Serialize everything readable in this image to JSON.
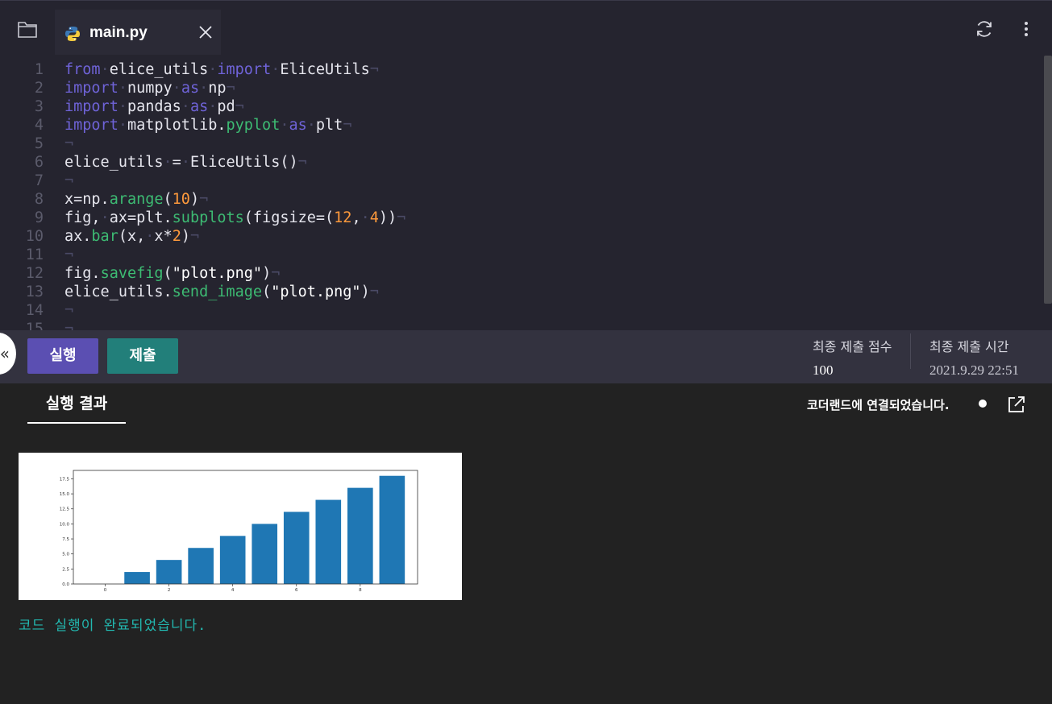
{
  "tab": {
    "filename": "main.py",
    "folder_icon": "folder-icon",
    "python_icon": "python-icon",
    "close_icon": "close-icon"
  },
  "toolbar": {
    "refresh_icon": "refresh-icon",
    "more_icon": "more-vertical-icon"
  },
  "code": {
    "lines": [
      {
        "n": "1",
        "tokens": [
          [
            "kw",
            "from"
          ],
          [
            "ws",
            "·"
          ],
          [
            "tx",
            "elice_utils"
          ],
          [
            "ws",
            "·"
          ],
          [
            "kw",
            "import"
          ],
          [
            "ws",
            "·"
          ],
          [
            "tx",
            "EliceUtils"
          ],
          [
            "ws",
            "¬"
          ]
        ]
      },
      {
        "n": "2",
        "tokens": [
          [
            "kw",
            "import"
          ],
          [
            "ws",
            "·"
          ],
          [
            "tx",
            "numpy"
          ],
          [
            "ws",
            "·"
          ],
          [
            "kw",
            "as"
          ],
          [
            "ws",
            "·"
          ],
          [
            "tx",
            "np"
          ],
          [
            "ws",
            "¬"
          ]
        ]
      },
      {
        "n": "3",
        "tokens": [
          [
            "kw",
            "import"
          ],
          [
            "ws",
            "·"
          ],
          [
            "tx",
            "pandas"
          ],
          [
            "ws",
            "·"
          ],
          [
            "kw",
            "as"
          ],
          [
            "ws",
            "·"
          ],
          [
            "tx",
            "pd"
          ],
          [
            "ws",
            "¬"
          ]
        ]
      },
      {
        "n": "4",
        "tokens": [
          [
            "kw",
            "import"
          ],
          [
            "ws",
            "·"
          ],
          [
            "tx",
            "matplotlib."
          ],
          [
            "fn",
            "pyplot"
          ],
          [
            "ws",
            "·"
          ],
          [
            "kw",
            "as"
          ],
          [
            "ws",
            "·"
          ],
          [
            "tx",
            "plt"
          ],
          [
            "ws",
            "¬"
          ]
        ]
      },
      {
        "n": "5",
        "tokens": [
          [
            "ws",
            "¬"
          ]
        ]
      },
      {
        "n": "6",
        "tokens": [
          [
            "tx",
            "elice_utils"
          ],
          [
            "ws",
            "·"
          ],
          [
            "tx",
            "="
          ],
          [
            "ws",
            "·"
          ],
          [
            "tx",
            "EliceUtils()"
          ],
          [
            "ws",
            "¬"
          ]
        ]
      },
      {
        "n": "7",
        "tokens": [
          [
            "ws",
            "¬"
          ]
        ]
      },
      {
        "n": "8",
        "tokens": [
          [
            "tx",
            "x=np."
          ],
          [
            "fn",
            "arange"
          ],
          [
            "tx",
            "("
          ],
          [
            "nm",
            "10"
          ],
          [
            "tx",
            ")"
          ],
          [
            "ws",
            "¬"
          ]
        ]
      },
      {
        "n": "9",
        "tokens": [
          [
            "tx",
            "fig,"
          ],
          [
            "ws",
            "·"
          ],
          [
            "tx",
            "ax=plt."
          ],
          [
            "fn",
            "subplots"
          ],
          [
            "tx",
            "(figsize=("
          ],
          [
            "nm",
            "12"
          ],
          [
            "tx",
            ","
          ],
          [
            "ws",
            "·"
          ],
          [
            "nm",
            "4"
          ],
          [
            "tx",
            "))"
          ],
          [
            "ws",
            "¬"
          ]
        ]
      },
      {
        "n": "10",
        "tokens": [
          [
            "tx",
            "ax."
          ],
          [
            "fn",
            "bar"
          ],
          [
            "tx",
            "(x,"
          ],
          [
            "ws",
            "·"
          ],
          [
            "tx",
            "x*"
          ],
          [
            "nm",
            "2"
          ],
          [
            "tx",
            ")"
          ],
          [
            "ws",
            "¬"
          ]
        ]
      },
      {
        "n": "11",
        "tokens": [
          [
            "ws",
            "¬"
          ]
        ]
      },
      {
        "n": "12",
        "tokens": [
          [
            "tx",
            "fig."
          ],
          [
            "fn",
            "savefig"
          ],
          [
            "tx",
            "("
          ],
          [
            "st",
            "\"plot.png\""
          ],
          [
            "tx",
            ")"
          ],
          [
            "ws",
            "¬"
          ]
        ]
      },
      {
        "n": "13",
        "tokens": [
          [
            "tx",
            "elice_utils."
          ],
          [
            "fn",
            "send_image"
          ],
          [
            "tx",
            "("
          ],
          [
            "st",
            "\"plot.png\""
          ],
          [
            "tx",
            ")"
          ],
          [
            "ws",
            "¬"
          ]
        ]
      },
      {
        "n": "14",
        "tokens": [
          [
            "ws",
            "¬"
          ]
        ]
      },
      {
        "n": "15",
        "tokens": [
          [
            "ws",
            "¬"
          ]
        ]
      }
    ]
  },
  "actions": {
    "collapse_label": "«",
    "run_label": "실행",
    "submit_label": "제출",
    "score_label": "최종 제출 점수",
    "score_value": "100",
    "time_label": "최종 제출 시간",
    "time_value": "2021.9.29 22:51"
  },
  "result": {
    "tab_label": "실행 결과",
    "connection_status": "코더랜드에 연결되었습니다.",
    "external_icon": "external-link-icon",
    "done_message": "코드 실행이 완료되었습니다."
  },
  "chart_data": {
    "type": "bar",
    "x": [
      0,
      1,
      2,
      3,
      4,
      5,
      6,
      7,
      8,
      9
    ],
    "values": [
      0,
      2,
      4,
      6,
      8,
      10,
      12,
      14,
      16,
      18
    ],
    "xticks": [
      "0",
      "2",
      "4",
      "6",
      "8"
    ],
    "yticks": [
      "0.0",
      "2.5",
      "5.0",
      "7.5",
      "10.0",
      "12.5",
      "15.0",
      "17.5"
    ],
    "xlim": [
      -1,
      9.8
    ],
    "ylim": [
      0,
      18.9
    ],
    "color": "#1f77b4",
    "grid": false
  }
}
